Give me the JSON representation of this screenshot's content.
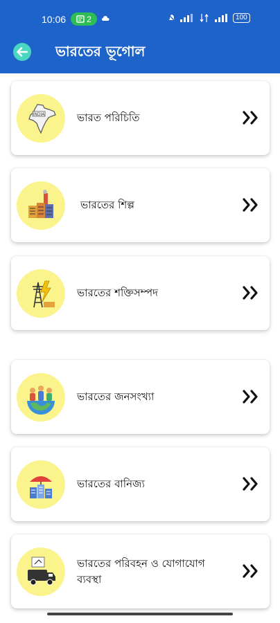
{
  "status_bar": {
    "time": "10:06",
    "notif_count": "2",
    "battery": "100"
  },
  "header": {
    "title": "ভারতের ভূগোল"
  },
  "colors": {
    "appbar": "#1d63c9",
    "back_button": "#4ad6c0",
    "icon_circle": "#fbf48d"
  },
  "items": [
    {
      "label": "ভারত পরিচিতি",
      "icon": "india-map-icon"
    },
    {
      "label": "ভারতের শিল্প",
      "icon": "factory-icon"
    },
    {
      "label": "ভারতের শক্তিসম্পদ",
      "icon": "power-tower-icon"
    },
    {
      "label": "ভারতের জনসংখ্যা",
      "icon": "population-icon"
    },
    {
      "label": "ভারতের বানিজ্য",
      "icon": "trade-icon"
    },
    {
      "label": "ভারতের পরিবহন ও যোগাযোগ ব্যবস্থা",
      "icon": "transport-icon"
    }
  ]
}
